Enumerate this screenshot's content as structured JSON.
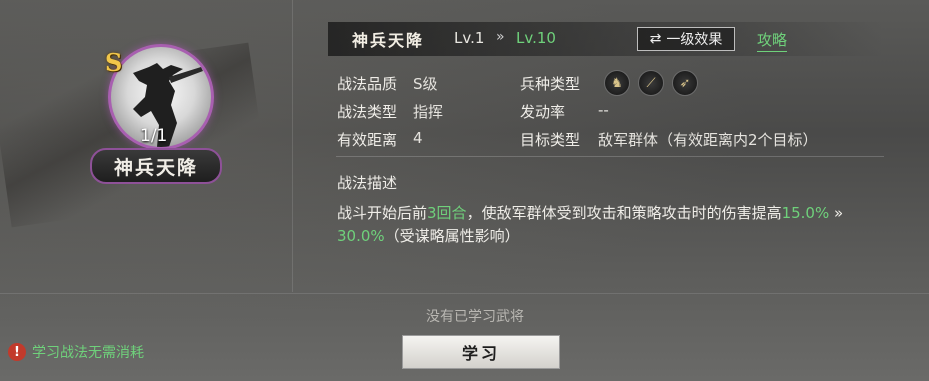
{
  "skill": {
    "grade_letter": "S",
    "count": "1/1",
    "name": "神兵天降"
  },
  "header": {
    "title": "神兵天降",
    "level_current": "Lv.1",
    "level_arrow": "»",
    "level_max": "Lv.10",
    "effect_button": "一级效果",
    "guide_link": "攻略"
  },
  "attributes": {
    "quality_label": "战法品质",
    "quality_value": "S级",
    "type_label": "战法类型",
    "type_value": "指挥",
    "range_label": "有效距离",
    "range_value": "4",
    "troop_label": "兵种类型",
    "rate_label": "发动率",
    "rate_value": "--",
    "target_label": "目标类型",
    "target_value": "敌军群体（有效距离内2个目标）"
  },
  "description": {
    "title": "战法描述",
    "part1": "战斗开始后前",
    "turns": "3回合",
    "part2": "，使敌军群体受到攻击和策略攻击时的伤害提高",
    "value_low": "15.0%",
    "arrow": " » ",
    "value_high": "30.0%",
    "part3": "（受谋略属性影响）"
  },
  "footer": {
    "no_general": "没有已学习武将",
    "learn_button": "学习",
    "notice": "学习战法无需消耗"
  },
  "colors": {
    "accent_green": "#6fd17b",
    "frame_purple": "#a85fb0",
    "grade_gold": "#f1c64a"
  }
}
